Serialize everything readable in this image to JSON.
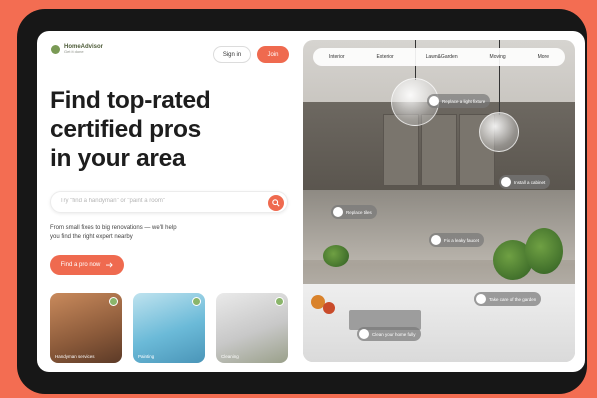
{
  "brand": {
    "name": "HomeAdvisor",
    "tagline": "Get it done"
  },
  "header": {
    "signin_label": "Sign in",
    "join_label": "Join"
  },
  "hero": {
    "headline_lines": [
      "Find top-rated",
      "certified pros",
      "in your area"
    ],
    "search_placeholder": "Try \"find a handyman\" or \"paint a room\"",
    "subtext_lines": [
      "From small fixes to big renovations — we'll help",
      "you find the right expert nearby"
    ],
    "cta_label": "Find a pro now"
  },
  "cards": [
    {
      "label": "Handyman services"
    },
    {
      "label": "Painting"
    },
    {
      "label": "Cleaning"
    }
  ],
  "photo_nav": [
    "Interior",
    "Exterior",
    "Lawn&Garden",
    "Moving",
    "More"
  ],
  "hotspots": [
    "Replace a light fixture",
    "Install a cabinet",
    "Replace tiles",
    "Fix a leaky faucet",
    "Take care of the garden",
    "Clean your home fully"
  ],
  "colors": {
    "accent": "#ef6a4f",
    "background": "#f36d52",
    "frame": "#171717",
    "logo_green": "#7a9a55"
  },
  "icons": {
    "search": "search-icon",
    "arrow": "arrow-right-icon",
    "check": "check-icon"
  }
}
